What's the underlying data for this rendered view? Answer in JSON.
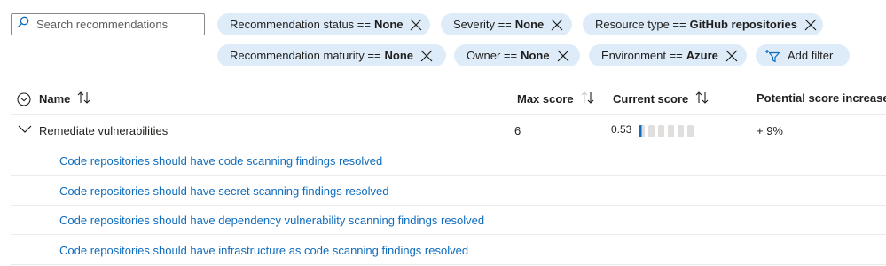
{
  "search": {
    "placeholder": "Search recommendations"
  },
  "filters": [
    {
      "label": "Recommendation status ==",
      "value": "None"
    },
    {
      "label": "Severity ==",
      "value": "None"
    },
    {
      "label": "Resource type ==",
      "value": "GitHub repositories"
    },
    {
      "label": "Recommendation maturity ==",
      "value": "None"
    },
    {
      "label": "Owner ==",
      "value": "None"
    },
    {
      "label": "Environment ==",
      "value": "Azure"
    }
  ],
  "add_filter_label": "Add filter",
  "table": {
    "columns": {
      "name": "Name",
      "max_score": "Max score",
      "current_score": "Current score",
      "potential_increase": "Potential score increase"
    },
    "group": {
      "name": "Remediate vulnerabilities",
      "max_score": "6",
      "current_score": "0.53",
      "current_score_fraction": 0.0883,
      "potential_increase": "+ 9%"
    },
    "items": [
      "Code repositories should have code scanning findings resolved",
      "Code repositories should have secret scanning findings resolved",
      "Code repositories should have dependency vulnerability scanning findings resolved",
      "Code repositories should have infrastructure as code scanning findings resolved"
    ]
  },
  "colors": {
    "pill_bg": "#deecf9",
    "link": "#0f6cbd",
    "bar_fill": "#0f6cbd",
    "bar_empty": "#e1dfdd"
  }
}
